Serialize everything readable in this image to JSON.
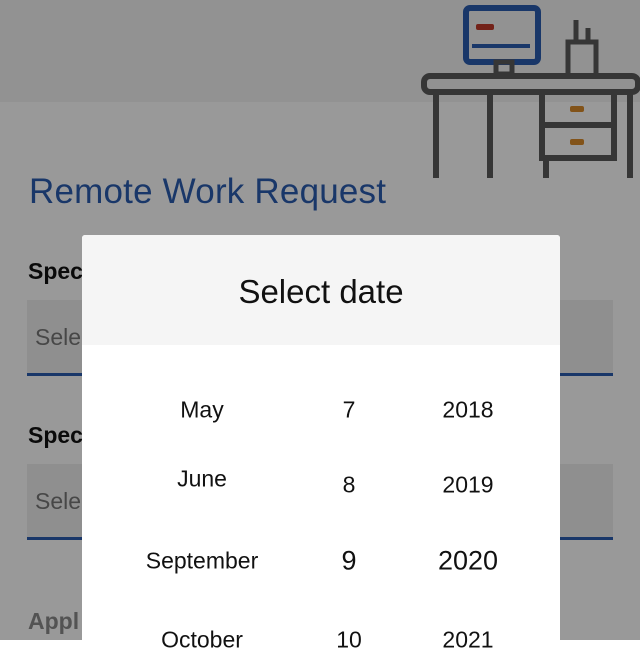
{
  "page": {
    "title": "Remote Work Request",
    "fields": [
      {
        "label": "Spec",
        "placeholder": "Sele"
      },
      {
        "label": "Spec",
        "placeholder": "Sele"
      }
    ],
    "apply_label": "Appl"
  },
  "dialog": {
    "title": "Select date",
    "months": [
      "May",
      "June",
      "September",
      "October"
    ],
    "days": [
      "7",
      "8",
      "9",
      "10"
    ],
    "years": [
      "2018",
      "2019",
      "2020",
      "2021"
    ],
    "selected": {
      "month": "September",
      "day": "9",
      "year": "2020"
    }
  },
  "illustration": {
    "name": "desk-with-monitor-icon",
    "colors": {
      "line": "#5a5a5a",
      "screen": "#2a5db0",
      "accent_red": "#c0392b",
      "accent_orange": "#d98b2b"
    }
  }
}
